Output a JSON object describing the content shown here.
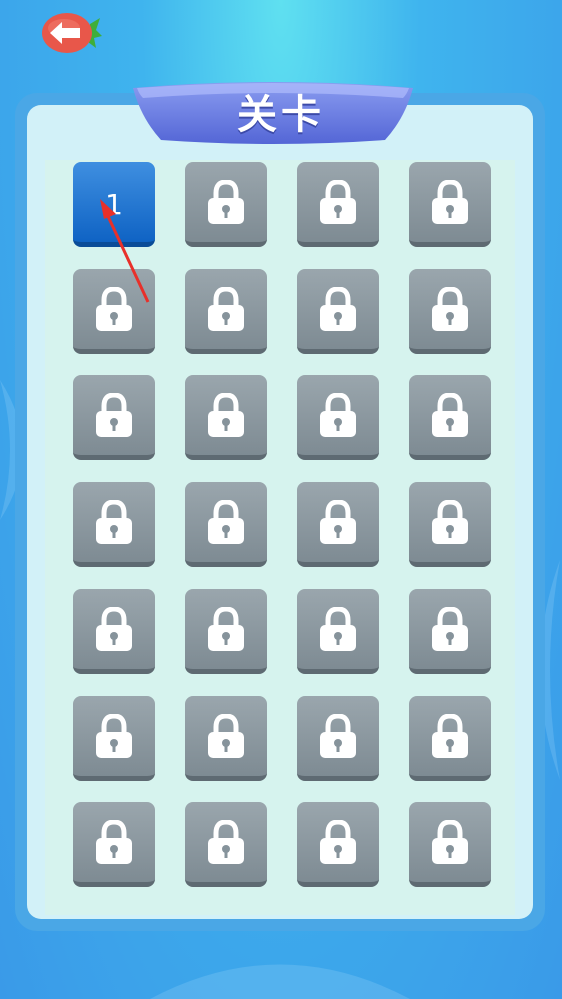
{
  "header": {
    "title": "关卡",
    "back_icon": "left-arrow-icon"
  },
  "levels": {
    "columns": 4,
    "rows": 7,
    "items": [
      {
        "label": "1",
        "state": "unlocked"
      },
      {
        "label": "",
        "state": "locked"
      },
      {
        "label": "",
        "state": "locked"
      },
      {
        "label": "",
        "state": "locked"
      },
      {
        "label": "",
        "state": "locked"
      },
      {
        "label": "",
        "state": "locked"
      },
      {
        "label": "",
        "state": "locked"
      },
      {
        "label": "",
        "state": "locked"
      },
      {
        "label": "",
        "state": "locked"
      },
      {
        "label": "",
        "state": "locked"
      },
      {
        "label": "",
        "state": "locked"
      },
      {
        "label": "",
        "state": "locked"
      },
      {
        "label": "",
        "state": "locked"
      },
      {
        "label": "",
        "state": "locked"
      },
      {
        "label": "",
        "state": "locked"
      },
      {
        "label": "",
        "state": "locked"
      },
      {
        "label": "",
        "state": "locked"
      },
      {
        "label": "",
        "state": "locked"
      },
      {
        "label": "",
        "state": "locked"
      },
      {
        "label": "",
        "state": "locked"
      },
      {
        "label": "",
        "state": "locked"
      },
      {
        "label": "",
        "state": "locked"
      },
      {
        "label": "",
        "state": "locked"
      },
      {
        "label": "",
        "state": "locked"
      },
      {
        "label": "",
        "state": "locked"
      },
      {
        "label": "",
        "state": "locked"
      },
      {
        "label": "",
        "state": "locked"
      },
      {
        "label": "",
        "state": "locked"
      }
    ]
  },
  "colors": {
    "unlocked_tile": "#1a6fcf",
    "locked_tile": "#86939b",
    "panel_border": "#4aa7e6",
    "banner": "#6a7fe0",
    "back_button": "#e8574a",
    "pointer_arrow": "#e8302a"
  }
}
